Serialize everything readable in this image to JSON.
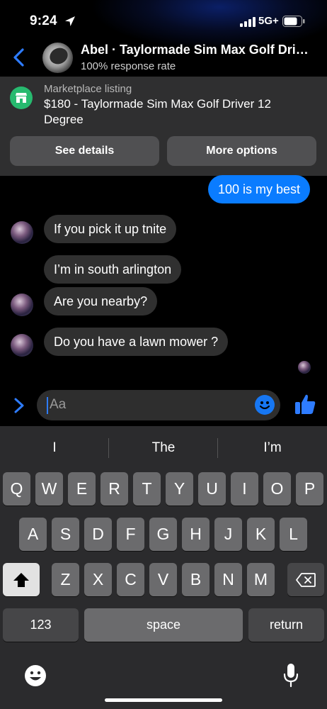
{
  "status_bar": {
    "time": "9:24",
    "network": "5G+"
  },
  "header": {
    "title": "Abel · Taylormade Sim Max Golf Driver 12 Degree",
    "subtitle": "100% response rate"
  },
  "listing": {
    "label": "Marketplace listing",
    "title": "$180 - Taylormade Sim Max Golf Driver 12 Degree",
    "buttons": {
      "details": "See details",
      "options": "More options"
    }
  },
  "messages": [
    {
      "from": "me",
      "text": "100 is my best"
    },
    {
      "from": "them",
      "text": "If you pick it up tnite"
    },
    {
      "from": "them",
      "text": "I’m in south arlington"
    },
    {
      "from": "them",
      "text": "Are you nearby?"
    },
    {
      "from": "them",
      "text": "Do you have a lawn mower ?"
    }
  ],
  "composer": {
    "placeholder": "Aa"
  },
  "keyboard": {
    "suggestions": [
      "I",
      "The",
      "I’m"
    ],
    "row1": [
      "Q",
      "W",
      "E",
      "R",
      "T",
      "Y",
      "U",
      "I",
      "O",
      "P"
    ],
    "row2": [
      "A",
      "S",
      "D",
      "F",
      "G",
      "H",
      "J",
      "K",
      "L"
    ],
    "row3": [
      "Z",
      "X",
      "C",
      "V",
      "B",
      "N",
      "M"
    ],
    "numbers_label": "123",
    "space_label": "space",
    "return_label": "return"
  },
  "colors": {
    "accent": "#0a7cff",
    "marketplace": "#27ba6f",
    "bubble_in": "#303030"
  },
  "icons": [
    "location-arrow-icon",
    "signal-bars-icon",
    "battery-icon",
    "back-chevron-icon",
    "marketplace-shop-icon",
    "expand-chevron-icon",
    "emoji-icon",
    "thumbs-up-icon",
    "shift-icon",
    "backspace-icon",
    "emoji-keyboard-icon",
    "microphone-icon"
  ]
}
